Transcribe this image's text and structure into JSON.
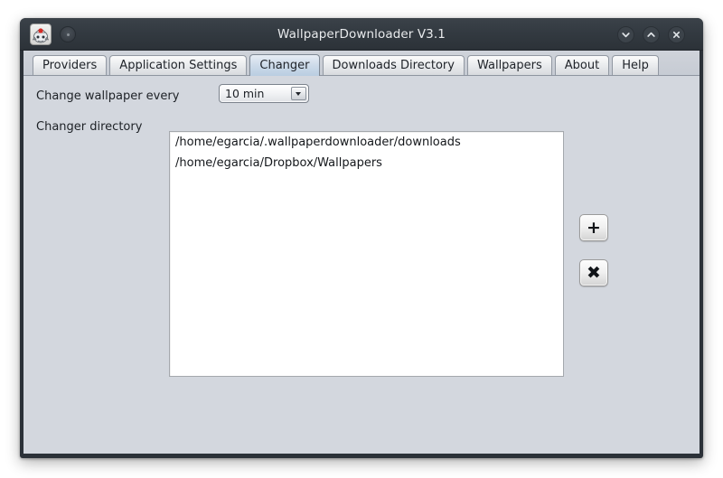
{
  "window": {
    "title": "WallpaperDownloader V3.1",
    "app_icon": "duke-app-icon",
    "menu_button": "window-menu-dot",
    "controls": {
      "minimize": "chevron-down-icon",
      "maximize": "chevron-up-icon",
      "close": "close-icon"
    }
  },
  "tabs": [
    {
      "label": "Providers",
      "selected": false
    },
    {
      "label": "Application Settings",
      "selected": false
    },
    {
      "label": "Changer",
      "selected": true
    },
    {
      "label": "Downloads Directory",
      "selected": false
    },
    {
      "label": "Wallpapers",
      "selected": false
    },
    {
      "label": "About",
      "selected": false
    },
    {
      "label": "Help",
      "selected": false
    }
  ],
  "changer": {
    "interval_label": "Change wallpaper every",
    "interval_value": "10 min",
    "directory_label": "Changer directory",
    "directories": [
      "/home/egarcia/.wallpaperdownloader/downloads",
      "/home/egarcia/Dropbox/Wallpapers"
    ],
    "add_button": "+",
    "remove_button": "✖"
  },
  "colors": {
    "titlebar": "#2f363d",
    "panel": "#d3d7de",
    "selected_tab": "#c3d4e5",
    "listbox": "#ffffff"
  }
}
